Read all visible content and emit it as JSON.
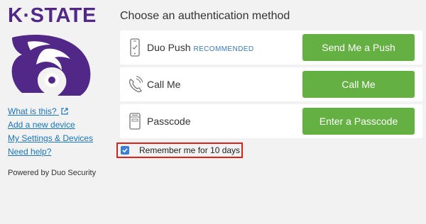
{
  "brand": {
    "logo_text": "K·STATE",
    "colors": {
      "purple": "#512888",
      "green": "#65b042",
      "link": "#1a75bc",
      "highlight": "#e0201b"
    }
  },
  "sidebar": {
    "links": [
      {
        "label": "What is this?",
        "icon": "external-link-icon"
      },
      {
        "label": "Add a new device"
      },
      {
        "label": "My Settings & Devices"
      },
      {
        "label": "Need help?"
      }
    ],
    "powered_by": "Powered by Duo Security"
  },
  "main": {
    "heading": "Choose an authentication method",
    "methods": [
      {
        "icon": "mobile-phone-icon",
        "label": "Duo Push",
        "badge": "RECOMMENDED",
        "button": "Send Me a Push"
      },
      {
        "icon": "phone-call-icon",
        "label": "Call Me",
        "button": "Call Me"
      },
      {
        "icon": "passcode-device-icon",
        "label": "Passcode",
        "button": "Enter a Passcode"
      }
    ],
    "remember": {
      "label": "Remember me for 10 days",
      "checked": true
    }
  }
}
